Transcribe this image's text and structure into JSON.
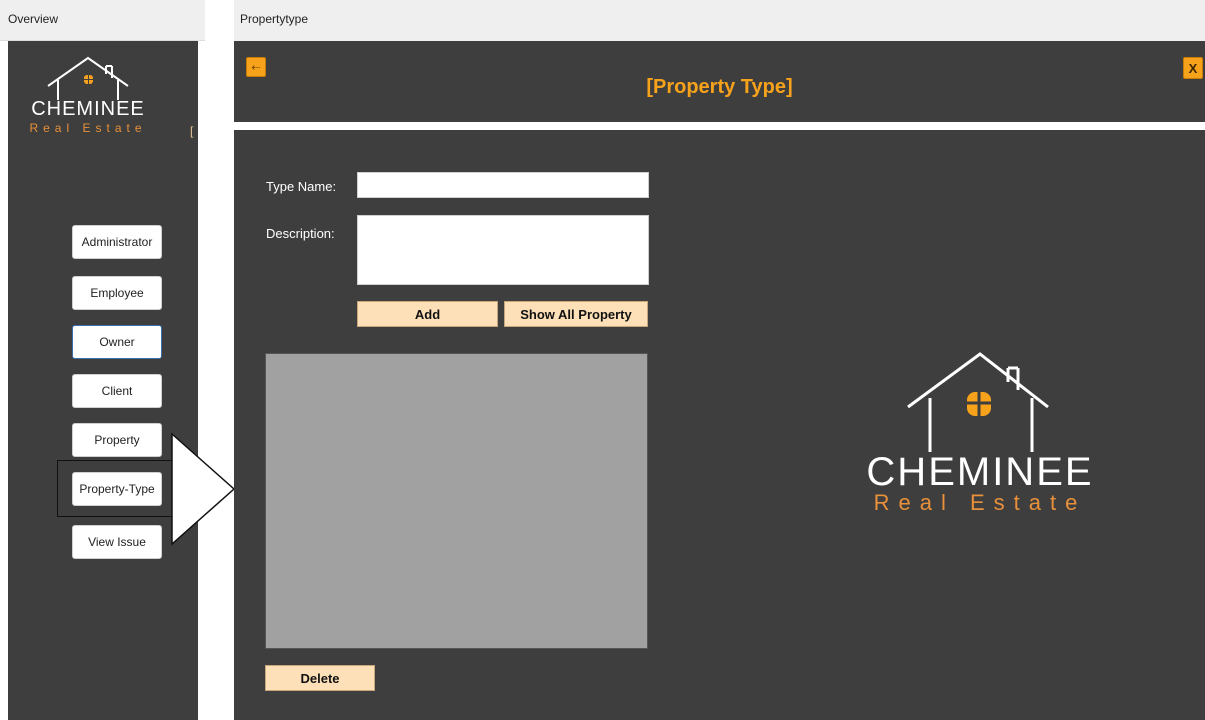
{
  "overview": {
    "title": "Overview",
    "brand_name": "CHEMINEE",
    "brand_sub": "Real Estate",
    "cut_char": "[",
    "nav": [
      {
        "label": "Administrator"
      },
      {
        "label": "Employee"
      },
      {
        "label": "Owner"
      },
      {
        "label": "Client"
      },
      {
        "label": "Property"
      },
      {
        "label": "Property-Type"
      },
      {
        "label": "View Issue"
      }
    ]
  },
  "window": {
    "title": "Propertytype",
    "heading": "[Property Type]",
    "back_icon": "back-arrow-icon",
    "close_label": "X"
  },
  "form": {
    "type_name_label": "Type Name:",
    "type_name_value": "",
    "description_label": "Description:",
    "description_value": "",
    "add_label": "Add",
    "show_all_label": "Show All Property",
    "delete_label": "Delete"
  },
  "brand": {
    "name": "CHEMINEE",
    "sub": "Real Estate"
  },
  "colors": {
    "panel_bg": "#3e3e3e",
    "accent_orange": "#f7a21b",
    "button_peach": "#fde0b8",
    "grid_gray": "#a1a1a1"
  }
}
